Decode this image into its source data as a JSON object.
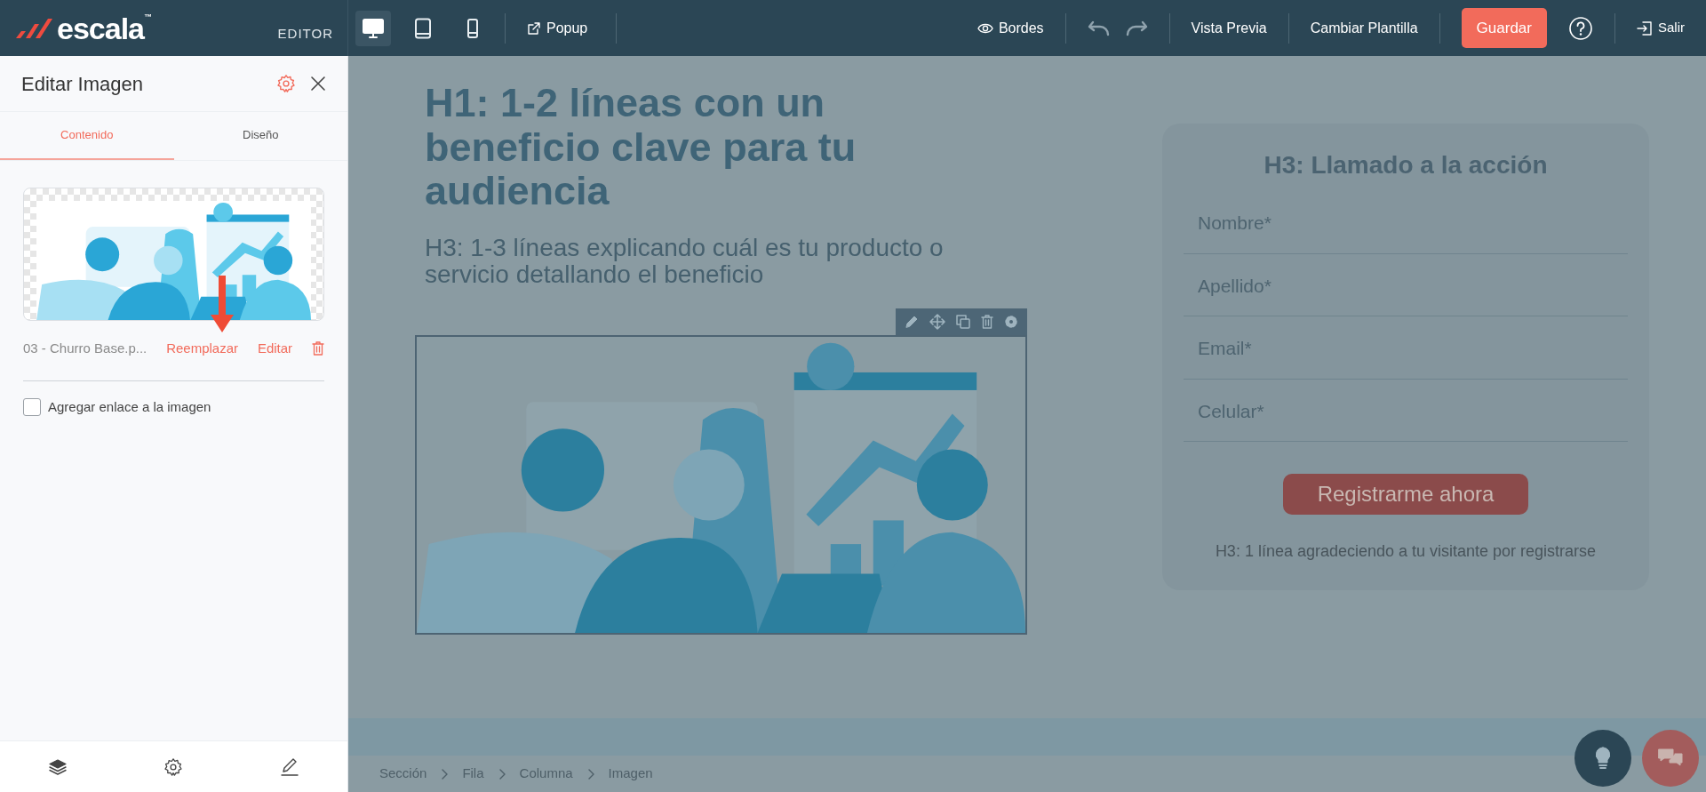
{
  "app": {
    "logo": "escala$^{™}$",
    "mode": "EDITOR"
  },
  "toolbar": {
    "devices": [
      {
        "kind": "desktop",
        "selected": true
      },
      {
        "kind": "tablet",
        "selected": false
      },
      {
        "kind": "mobile",
        "selected": false
      }
    ],
    "popup": "Popup",
    "borders": "Bordes",
    "preview": "Vista Previa",
    "template": "Cambiar Plantilla",
    "save": "Guardar",
    "exit": "Salir"
  },
  "panel": {
    "title": "Editar Imagen",
    "tabs": [
      {
        "label": "Contenido",
        "selected": true
      },
      {
        "label": "Diseño",
        "selected": false
      }
    ],
    "file_name": "03 - Churro Base.p...",
    "replace": "Reemplazar",
    "edit": "Editar",
    "link_option": {
      "label": "Agregar enlace a la imagen",
      "checked": false
    }
  },
  "canvas": {
    "headline": "H1: 1-2 líneas con un beneficio clave para tu audiencia",
    "subheadline": "H3: 1-3 líneas explicando cuál es tu producto o servicio detallando el beneficio",
    "form": {
      "title": "H3: Llamado a la acción",
      "fields": [
        {
          "placeholder": "Nombre*"
        },
        {
          "placeholder": "Apellido*"
        },
        {
          "placeholder": "Email*"
        },
        {
          "placeholder": "Celular*"
        }
      ],
      "submit": "Registrarme ahora",
      "note": "H3: 1 línea agradeciendo a tu visitante por registrarse"
    }
  },
  "breadcrumb": [
    "Sección",
    "Fila",
    "Columna",
    "Imagen"
  ]
}
